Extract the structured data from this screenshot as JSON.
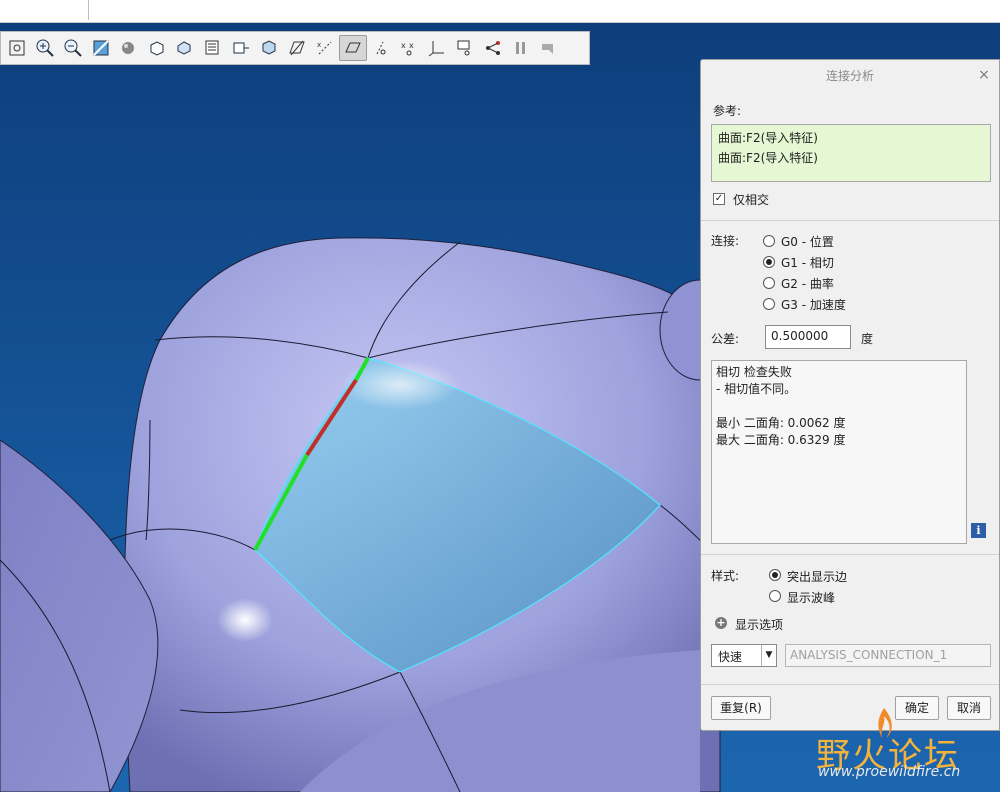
{
  "colors": {
    "background_top": "#0d3d7a",
    "background_bottom": "#1c66b0",
    "surface": "#9ea2dd",
    "highlight_patch": "#5fa8d8",
    "edge_green": "#22e02a",
    "edge_red": "#c0302a",
    "reference_box": "#e6f7d4"
  },
  "toolbar": {
    "icons": [
      "refit-icon",
      "zoom-in-icon",
      "zoom-out-icon",
      "repaint-icon",
      "display-style-icon",
      "saved-orientations-icon",
      "named-views-icon",
      "view-manager-icon",
      "perspective-icon",
      "section-icon",
      "plane-display-icon",
      "axis-display-icon",
      "point-display-icon",
      "csys-display-icon",
      "annotation-display-icon",
      "plane-tag-icon",
      "point-tag-icon",
      "csys-tag-icon",
      "spin-center-icon",
      "sketch-icon",
      "pause-icon",
      "next-icon"
    ]
  },
  "dialog": {
    "title": "连接分析",
    "close_glyph": "×",
    "reference_label": "参考:",
    "references": [
      "曲面:F2(导入特征)",
      "曲面:F2(导入特征)"
    ],
    "intersect_only_label": "仅相交",
    "intersect_only_checked": true,
    "connection_label": "连接:",
    "connection_options": [
      "G0 - 位置",
      "G1 - 相切",
      "G2 - 曲率",
      "G3 - 加速度"
    ],
    "connection_selected": "G1 - 相切",
    "tolerance_label": "公差:",
    "tolerance_value": "0.500000",
    "tolerance_unit": "度",
    "result_lines": [
      "相切 检查失败",
      "- 相切值不同。",
      "",
      "最小 二面角: 0.0062 度",
      "最大 二面角: 0.6329 度"
    ],
    "info_glyph": "i",
    "style_label": "样式:",
    "style_options": [
      "突出显示边",
      "显示波峰"
    ],
    "style_selected": "突出显示边",
    "display_options_label": "显示选项",
    "mode_value": "快速",
    "mode_arrow": "▼",
    "analysis_name": "ANALYSIS_CONNECTION_1",
    "reset_label": "重复(R)",
    "ok_label": "确定",
    "cancel_label": "取消"
  },
  "watermark": {
    "text": "野火论坛",
    "url": "www.proewildfire.cn"
  }
}
